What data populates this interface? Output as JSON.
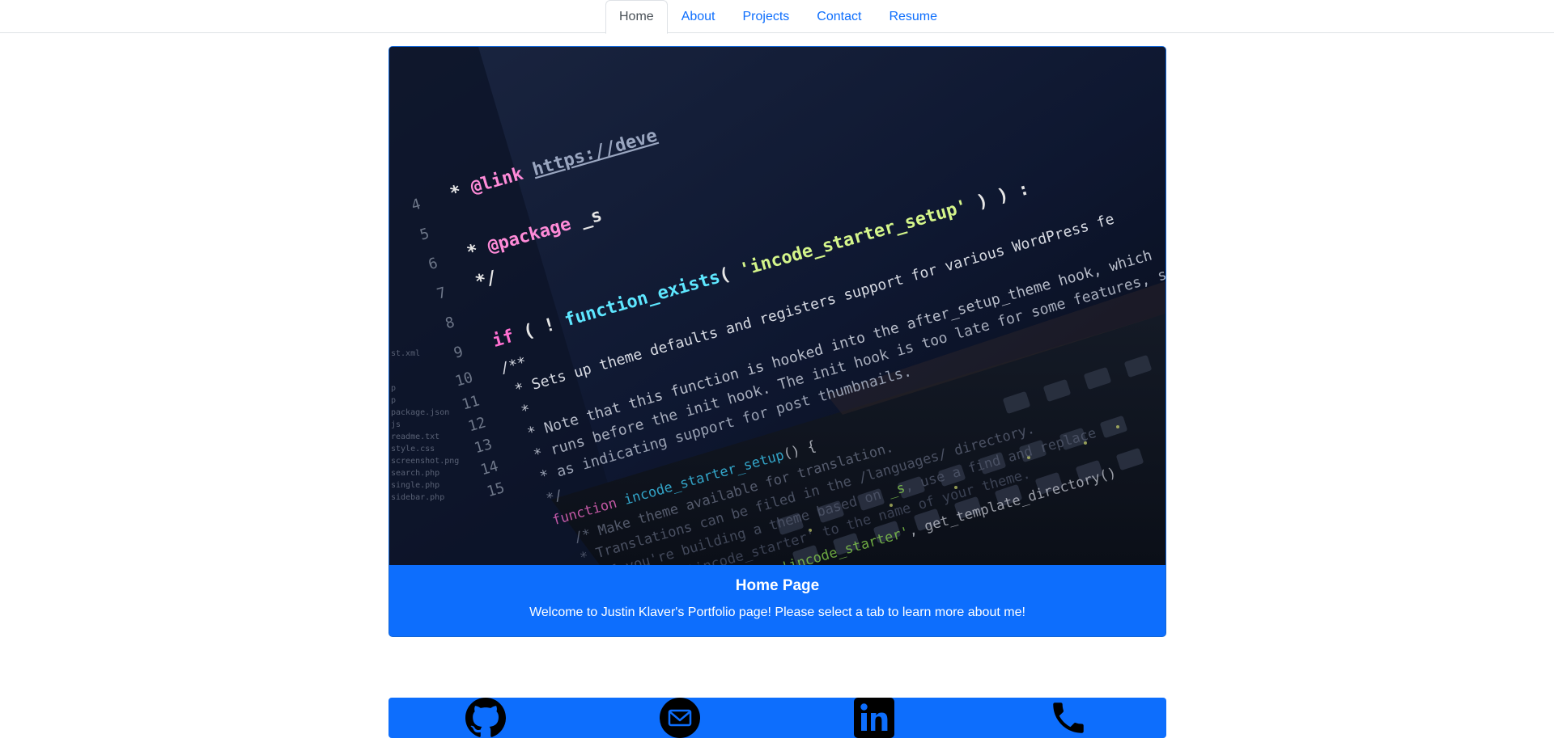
{
  "nav": {
    "tabs": [
      {
        "label": "Home",
        "active": true
      },
      {
        "label": "About",
        "active": false
      },
      {
        "label": "Projects",
        "active": false
      },
      {
        "label": "Contact",
        "active": false
      },
      {
        "label": "Resume",
        "active": false
      }
    ]
  },
  "hero": {
    "image_icon": "code-on-laptop-photo",
    "caption_title": "Home Page",
    "caption_text": "Welcome to Justin Klaver's Portfolio page! Please select a tab to learn more about me!"
  },
  "social": {
    "icons": [
      "github-icon",
      "email-icon",
      "linkedin-icon",
      "phone-icon"
    ]
  },
  "colors": {
    "accent": "#0d6efd",
    "tab_link": "#0d6efd",
    "tab_active_text": "#495057",
    "icon": "#000000"
  }
}
